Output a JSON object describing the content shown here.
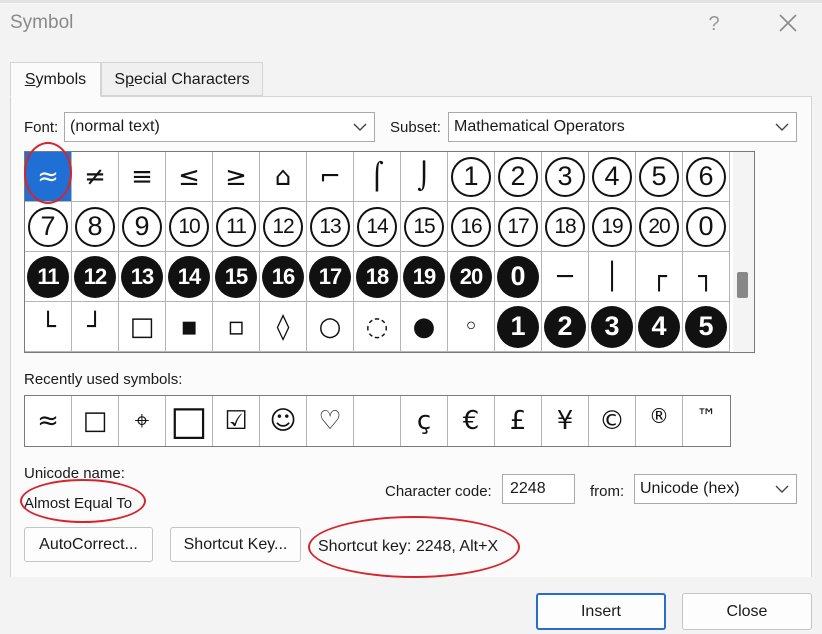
{
  "window": {
    "title": "Symbol",
    "help_label": "?"
  },
  "tabs": [
    {
      "label": "Symbols",
      "accel": "S",
      "rest": "ymbols"
    },
    {
      "label": "Special Characters",
      "accel": "P",
      "pre": "S",
      "rest": "ecial Characters"
    }
  ],
  "font": {
    "label": "Font:",
    "value": "(normal text)"
  },
  "subset": {
    "label": "Subset:",
    "value": "Mathematical Operators"
  },
  "symbols": [
    [
      "≈",
      "≠",
      "≡",
      "≤",
      "≥",
      "⌂",
      "⌐",
      "⌠",
      "⌡",
      "①",
      "②",
      "③",
      "④",
      "⑤",
      "⑥"
    ],
    [
      "⑦",
      "⑧",
      "⑨",
      "⑩",
      "⑪",
      "⑫",
      "⑬",
      "⑭",
      "⑮",
      "⑯",
      "⑰",
      "⑱",
      "⑲",
      "⑳",
      "⓪"
    ],
    [
      "⓫",
      "⓬",
      "⓭",
      "⓮",
      "⓯",
      "⓰",
      "⓱",
      "⓲",
      "⓳",
      "⓴",
      "⓿",
      "─",
      "│",
      "┌",
      "┐"
    ],
    [
      "└",
      "┘",
      "□",
      "▪",
      "▫",
      "◊",
      "○",
      "◌",
      "●",
      "◦",
      "❶",
      "❷",
      "❸",
      "❹",
      "❺"
    ]
  ],
  "selected_symbol": "≈",
  "recent": {
    "label": "Recently used symbols:",
    "items": [
      "≈",
      "□",
      "⌖",
      "□",
      "☑",
      "☺",
      "♡",
      " ",
      "ç",
      "€",
      "£",
      "¥",
      "©",
      "®",
      "™"
    ]
  },
  "unicode": {
    "label": "Unicode name:",
    "value": "Almost Equal To"
  },
  "char_code": {
    "label": "Character code:",
    "value": "2248"
  },
  "from": {
    "label": "from:",
    "value": "Unicode (hex)"
  },
  "buttons": {
    "autocorrect": "AutoCorrect...",
    "shortcut_key": "Shortcut Key...",
    "insert": "Insert",
    "close": "Close"
  },
  "shortcut_info": "Shortcut key: 2248, Alt+X",
  "colors": {
    "selection": "#1f6fd4",
    "annotation": "#d6262b",
    "primary_border": "#2a6bcf"
  }
}
